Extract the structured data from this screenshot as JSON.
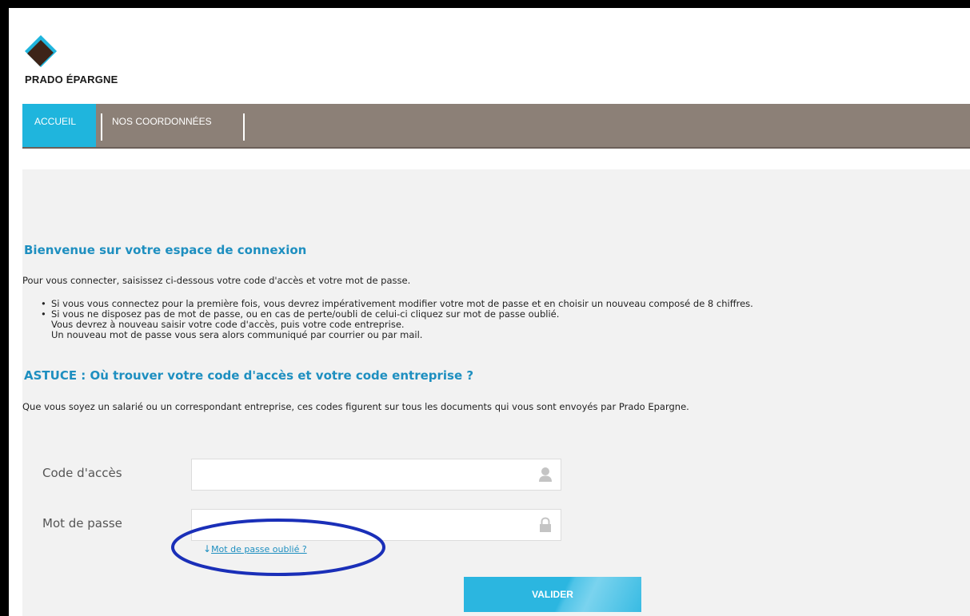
{
  "header": {
    "brand": "PRADO ÉPARGNE"
  },
  "nav": {
    "items": [
      {
        "label": "ACCUEIL"
      },
      {
        "label": "NOS COORDONNÉES"
      }
    ]
  },
  "main": {
    "welcome_title": "Bienvenue sur votre espace de connexion",
    "intro": "Pour vous connecter, saisissez ci-dessous votre code d'accès et votre mot de passe.",
    "bullets": [
      "Si vous vous connectez pour la première fois, vous devrez impérativement modifier votre mot de passe et en choisir un nouveau composé de 8 chiffres.",
      "Si vous ne disposez pas de mot de passe, ou en cas de perte/oubli de celui-ci cliquez sur mot de passe oublié."
    ],
    "bullet_continuation": [
      "Vous devrez à nouveau saisir votre code d'accès, puis votre code entreprise.",
      "Un nouveau mot de passe vous sera alors communiqué par courrier ou par mail."
    ],
    "astuce_title": "ASTUCE : Où trouver votre code d'accès et votre code entreprise ?",
    "astuce_text": "Que vous soyez un salarié ou un correspondant entreprise, ces codes figurent sur tous les documents qui vous sont envoyés par Prado Epargne."
  },
  "form": {
    "access_code_label": "Code d'accès",
    "access_code_value": "",
    "password_label": "Mot de passe",
    "password_value": "",
    "forgot_arrow": "↓",
    "forgot_label": "Mot de passe oublié ?",
    "submit_label": "VALIDER"
  },
  "colors": {
    "accent": "#1fb5dd",
    "nav_bg": "#8c8077",
    "heading": "#1e8fc0",
    "annotation": "#1a2fb8"
  },
  "icons": [
    "logo-icon",
    "user-icon",
    "lock-icon",
    "down-arrow-icon"
  ]
}
